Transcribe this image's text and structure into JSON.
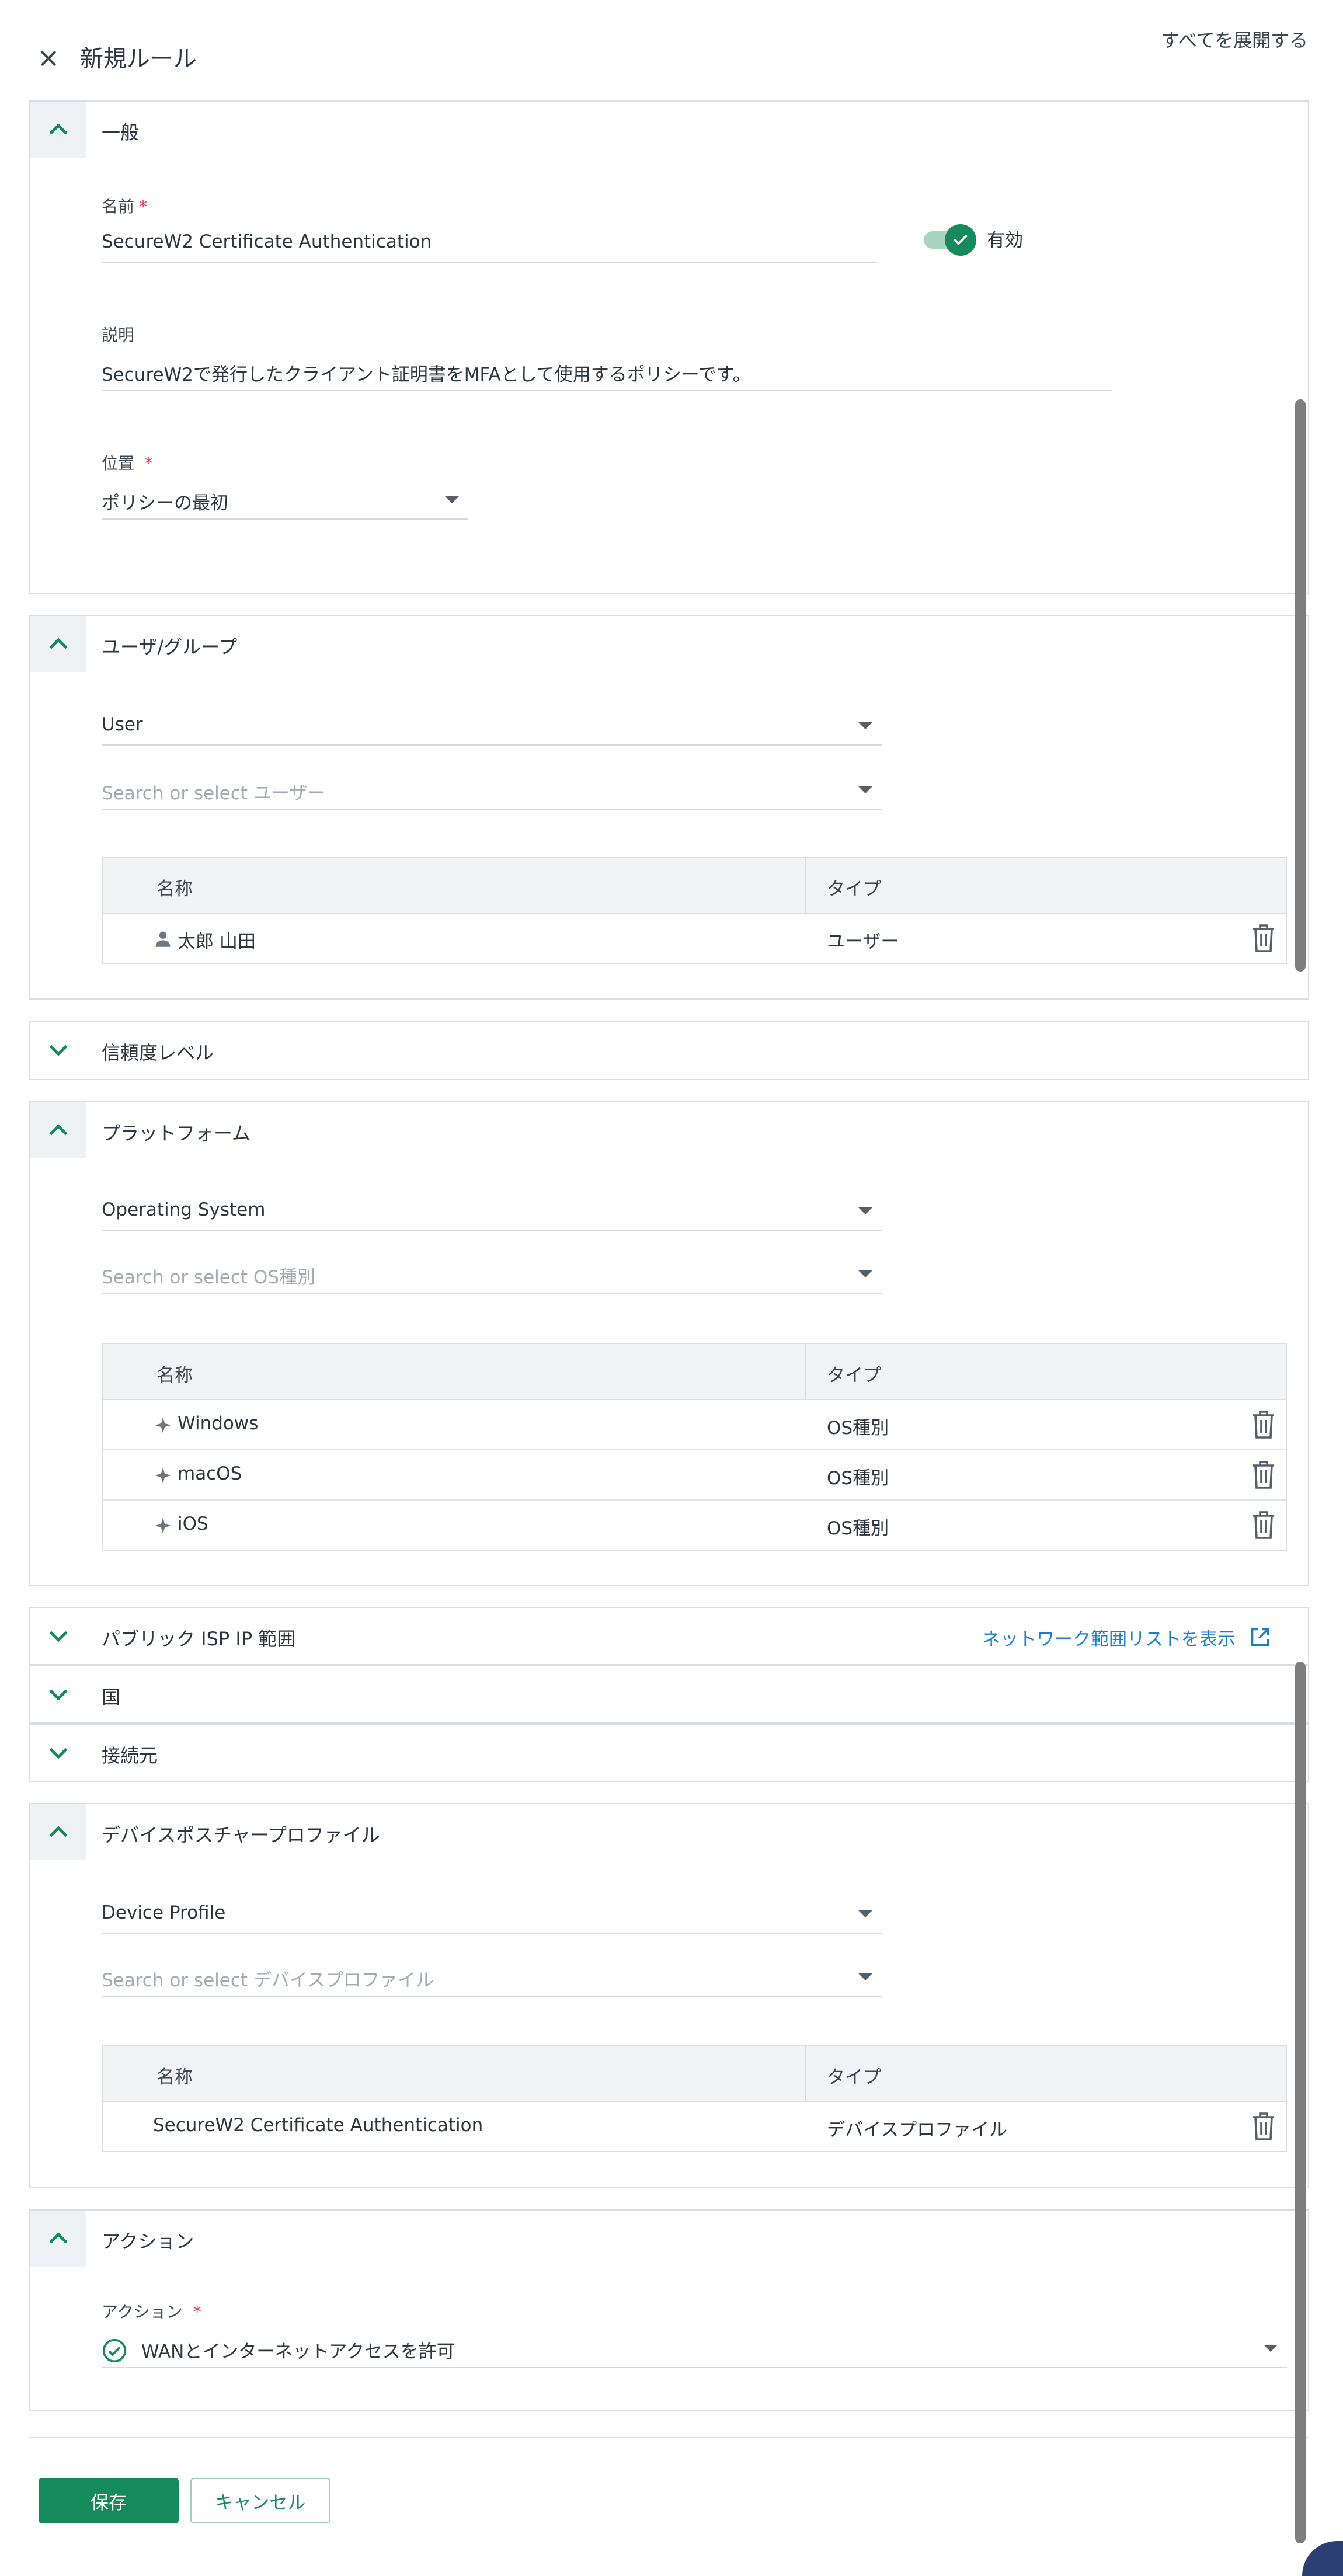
{
  "header": {
    "title": "新規ルール",
    "expand_all": "すべてを展開する"
  },
  "general": {
    "title": "一般",
    "name_label": "名前",
    "name_value": "SecureW2 Certificate Authentication",
    "enabled_label": "有効",
    "desc_label": "説明",
    "desc_value": "SecureW2で発行したクライアント証明書をMFAとして使用するポリシーです。",
    "position_label": "位置",
    "position_value": "ポリシーの最初",
    "required_mark": "*"
  },
  "users": {
    "title": "ユーザ/グループ",
    "type_value": "User",
    "search_placeholder": "Search or select ユーザー",
    "col_name": "名称",
    "col_type": "タイプ",
    "rows": [
      {
        "name": "太郎 山田",
        "type": "ユーザー"
      }
    ]
  },
  "trust": {
    "title": "信頼度レベル"
  },
  "platform": {
    "title": "プラットフォーム",
    "type_value": "Operating System",
    "search_placeholder": "Search or select OS種別",
    "col_name": "名称",
    "col_type": "タイプ",
    "rows": [
      {
        "name": "Windows",
        "type": "OS種別"
      },
      {
        "name": "macOS",
        "type": "OS種別"
      },
      {
        "name": "iOS",
        "type": "OS種別"
      }
    ]
  },
  "isp": {
    "title": "パブリック ISP IP 範囲",
    "link": "ネットワーク範囲リストを表示"
  },
  "country": {
    "title": "国"
  },
  "source": {
    "title": "接続元"
  },
  "posture": {
    "title": "デバイスポスチャープロファイル",
    "type_value": "Device Profile",
    "search_placeholder": "Search or select デバイスプロファイル",
    "col_name": "名称",
    "col_type": "タイプ",
    "rows": [
      {
        "name": "SecureW2 Certificate Authentication",
        "type": "デバイスプロファイル"
      }
    ]
  },
  "action": {
    "title": "アクション",
    "label": "アクション",
    "value": "WANとインターネットアクセスを許可"
  },
  "buttons": {
    "save": "保存",
    "cancel": "キャンセル"
  },
  "colors": {
    "accent": "#158a5d",
    "link": "#1a7fd4",
    "required": "#e0334a"
  }
}
